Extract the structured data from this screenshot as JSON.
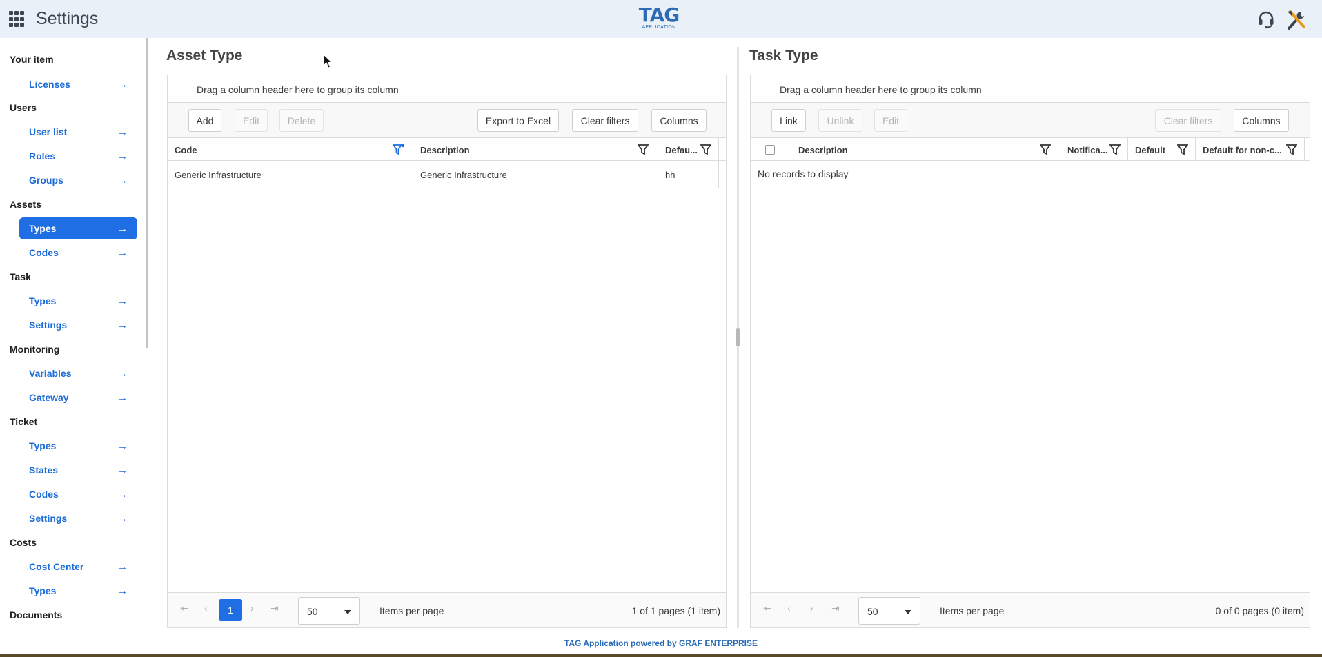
{
  "header": {
    "title": "Settings",
    "logo_main": "TAG",
    "logo_sub": "APPLICATION"
  },
  "sidebar": {
    "sections": [
      {
        "label": "Your item",
        "items": [
          {
            "label": "Licenses"
          }
        ]
      },
      {
        "label": "Users",
        "items": [
          {
            "label": "User list"
          },
          {
            "label": "Roles"
          },
          {
            "label": "Groups"
          }
        ]
      },
      {
        "label": "Assets",
        "items": [
          {
            "label": "Types",
            "active": true
          },
          {
            "label": "Codes"
          }
        ]
      },
      {
        "label": "Task",
        "items": [
          {
            "label": "Types"
          },
          {
            "label": "Settings"
          }
        ]
      },
      {
        "label": "Monitoring",
        "items": [
          {
            "label": "Variables"
          },
          {
            "label": "Gateway"
          }
        ]
      },
      {
        "label": "Ticket",
        "items": [
          {
            "label": "Types"
          },
          {
            "label": "States"
          },
          {
            "label": "Codes"
          },
          {
            "label": "Settings"
          }
        ]
      },
      {
        "label": "Costs",
        "items": [
          {
            "label": "Cost Center"
          },
          {
            "label": "Types"
          }
        ]
      },
      {
        "label": "Documents",
        "items": []
      }
    ],
    "arrow": "→"
  },
  "asset_type": {
    "title": "Asset Type",
    "group_hint": "Drag a column header here to group its column",
    "buttons": {
      "add": "Add",
      "edit": "Edit",
      "delete": "Delete",
      "export": "Export to Excel",
      "clear_filters": "Clear filters",
      "columns": "Columns"
    },
    "columns": [
      "Code",
      "Description",
      "Defau..."
    ],
    "rows": [
      [
        "Generic Infrastructure",
        "Generic Infrastructure",
        "hh"
      ]
    ],
    "pager": {
      "current_page": "1",
      "page_size": "50",
      "items_per_page": "Items per page",
      "info": "1 of 1 pages (1 item)"
    }
  },
  "task_type": {
    "title": "Task Type",
    "group_hint": "Drag a column header here to group its column",
    "buttons": {
      "link": "Link",
      "unlink": "Unlink",
      "edit": "Edit",
      "clear_filters": "Clear filters",
      "columns": "Columns"
    },
    "columns": [
      "Description",
      "Notifica...",
      "Default",
      "Default for non-c..."
    ],
    "empty": "No records to display",
    "pager": {
      "page_size": "50",
      "items_per_page": "Items per page",
      "info": "0 of 0 pages (0 item)"
    }
  },
  "footer": "TAG Application powered by GRAF ENTERPRISE",
  "colors": {
    "accent": "#1f6ee4",
    "header_bg": "#eaf0f8",
    "link": "#1b6cd8"
  }
}
